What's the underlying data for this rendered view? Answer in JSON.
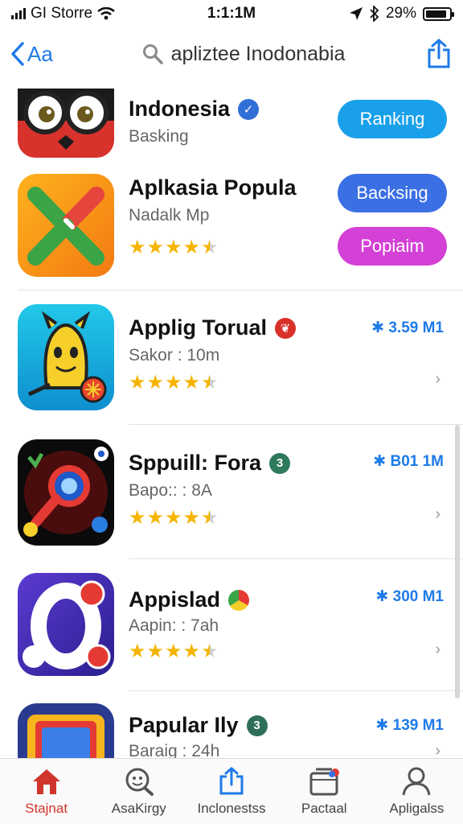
{
  "status_bar": {
    "carrier": "GI Storre",
    "time": "1:1:1M",
    "battery": "29%",
    "battery_level": 0.9
  },
  "nav": {
    "back_label": "Aa",
    "search_text": "apliztee Inodonabia"
  },
  "apps": [
    {
      "title": "Indonesia",
      "subtitle": "Basking",
      "badge_color": "#2f6fd6",
      "badge_symbol": "✓",
      "icon": "owl-face-icon",
      "buttons": [
        "Ranking"
      ]
    },
    {
      "title": "Aplkasia Popula",
      "subtitle": "Nadalk Mp",
      "rating": 4.5,
      "icon": "x-cross-icon",
      "buttons": [
        "Backsing",
        "Popiaim"
      ]
    },
    {
      "title": "Applig Torual",
      "subtitle": "Sakor : 10m",
      "size": "3.59 M1",
      "rating": 4.5,
      "badge_color": "#d8312a",
      "badge_symbol": "❦",
      "icon": "bell-mascot-icon"
    },
    {
      "title": "Sppuill: Fora",
      "subtitle": "Bapo:: : 8A",
      "size": "B01 1M",
      "rating": 4.5,
      "badge_color": "#2f7a5a",
      "badge_symbol": "3",
      "icon": "magnifier-game-icon"
    },
    {
      "title": "Appislad",
      "subtitle": "Aapin: : 7ah",
      "size": "300 M1",
      "rating": 4.5,
      "badge_color": "#e0a020",
      "badge_symbol": "●",
      "icon": "o-letter-icon"
    },
    {
      "title": "Papular Ily",
      "subtitle": "Baraig : 24h",
      "size": "139 M1",
      "badge_color": "#2f6f5a",
      "badge_symbol": "3",
      "icon": "folder-app-icon"
    }
  ],
  "tabs": [
    {
      "label": "Stajnat",
      "icon": "home-icon"
    },
    {
      "label": "AsaKirgy",
      "icon": "search-face-icon"
    },
    {
      "label": "Inclonestss",
      "icon": "share-icon"
    },
    {
      "label": "Pactaal",
      "icon": "inbox-icon"
    },
    {
      "label": "Apligalss",
      "icon": "person-icon"
    }
  ],
  "colors": {
    "accent": "#1e7ae8",
    "ranking_pill": "#1aa0ea",
    "backsing_pill": "#3b6fe4",
    "popiaim_pill": "#d441d6",
    "star": "#f5b400",
    "active_tab": "#d0342c"
  }
}
